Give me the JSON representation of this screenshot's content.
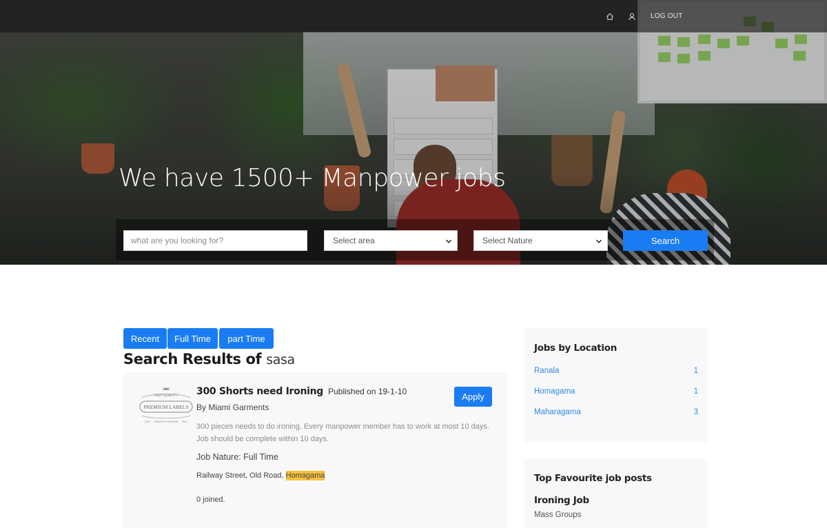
{
  "nav": {
    "home_icon": "home-icon",
    "user_icon": "user-icon",
    "logout_label": "LOG OUT"
  },
  "hero": {
    "headline": "We have 1500+ Manpower jobs"
  },
  "search": {
    "keyword_placeholder": "what are you looking for?",
    "area_selected": "Select area",
    "nature_selected": "Select Nature",
    "button_label": "Search"
  },
  "filters": {
    "recent": "Recent",
    "full_time": "Full Time",
    "part_time": "part Time"
  },
  "results": {
    "title_prefix": "Search Results of",
    "query": "sasa"
  },
  "job": {
    "title": "300 Shorts need Ironing",
    "published": "Published on 19-1-10",
    "company": "By Miami Garments",
    "apply_label": "Apply",
    "description": "300 pieces needs to do ironing. Every manpower member has to work at most 10 days. Job should be complete within 10 days.",
    "nature": "Job Nature: Full Time",
    "address_prefix": "Railway Street, Old Road,",
    "address_highlight": "Homagama",
    "joined": "0 joined.",
    "logo": {
      "top": "HIGH QUALITY",
      "main": "PREMIUM LABELS",
      "left": "2020",
      "middle": "CREATIVE FASHION",
      "right": "2024"
    }
  },
  "sidebar": {
    "locations_heading": "Jobs by Location",
    "locations": [
      {
        "name": "Ranala",
        "count": "1"
      },
      {
        "name": "Homagama",
        "count": "1"
      },
      {
        "name": "Maharagama",
        "count": "3"
      }
    ],
    "favourites_heading": "Top Favourite job posts",
    "favourite": {
      "title": "Ironing Job",
      "company": "Mass Groups"
    }
  },
  "colors": {
    "accent": "#1a7cf2",
    "link": "#2f8ae0",
    "highlight": "#f6c23e",
    "panel_bg": "#f8f8fb"
  }
}
